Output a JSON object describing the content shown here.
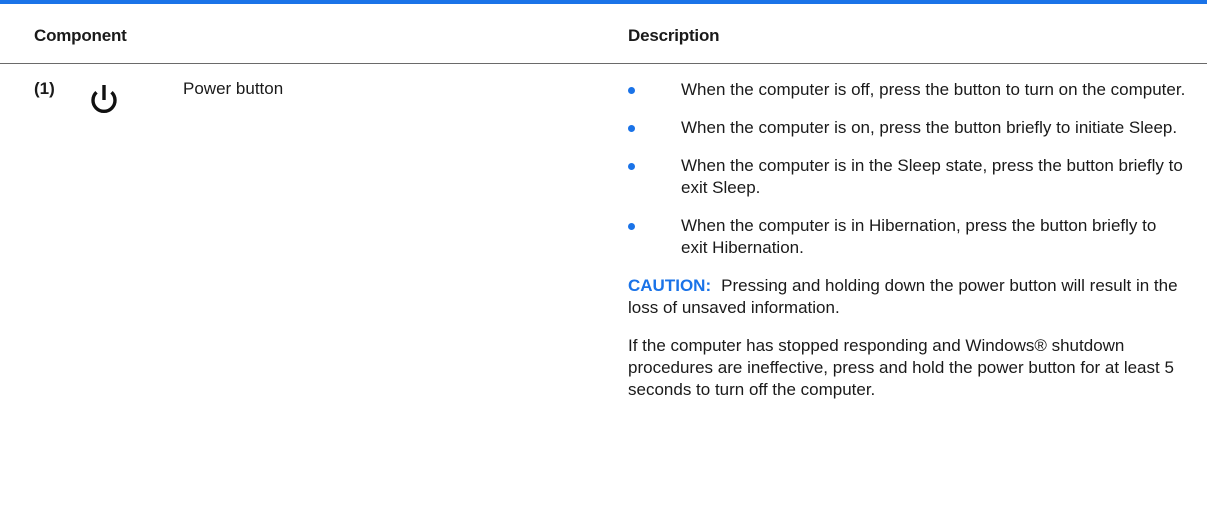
{
  "colors": {
    "accent": "#1a73e8"
  },
  "table": {
    "headers": {
      "component": "Component",
      "description": "Description"
    },
    "row": {
      "number": "(1)",
      "icon": "power-icon",
      "name": "Power button",
      "bullets": [
        "When the computer is off, press the button to turn on the computer.",
        "When the computer is on, press the button briefly to initiate Sleep.",
        "When the computer is in the Sleep state, press the button briefly to exit Sleep.",
        "When the computer is in Hibernation, press the button briefly to exit Hibernation."
      ],
      "caution_label": "CAUTION:",
      "caution_text": "Pressing and holding down the power button will result in the loss of unsaved information.",
      "note": "If the computer has stopped responding and Windows® shutdown procedures are ineffective, press and hold the power button for at least 5 seconds to turn off the computer."
    }
  }
}
